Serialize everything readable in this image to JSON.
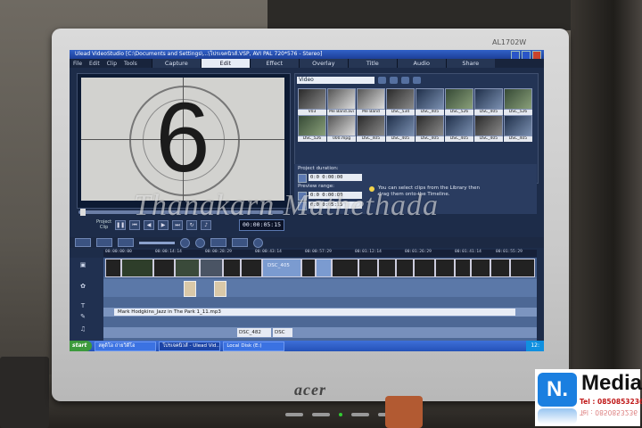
{
  "monitor": {
    "model": "AL1702W",
    "brand": "acer"
  },
  "window": {
    "title": "Ulead VideoStudio [C:\\Documents and Settings\\...\\โปรเจคนิวส์.VSP, AVI PAL 720*576 - Stereo]"
  },
  "menu": {
    "items": [
      "File",
      "Edit",
      "Clip",
      "Tools"
    ],
    "tabs": [
      "Capture",
      "Edit",
      "Effect",
      "Overlay",
      "Title",
      "Audio",
      "Share"
    ],
    "active_tab": "Edit"
  },
  "preview": {
    "countdown_number": "6",
    "project_label": "Project",
    "clip_label": "Clip",
    "timecode": "00:00:05:15"
  },
  "library": {
    "category": "Video",
    "thumbnails": [
      "V03",
      "Me Band.avi",
      "Me Band",
      "DSC_534",
      "DSC_405",
      "DSC_526",
      "DSC_405",
      "DSC_526",
      "DSC_526",
      "000.mpg",
      "DSC_405",
      "DSC_405",
      "DSC_405",
      "DSC_405",
      "DSC_405",
      "DSC_405"
    ]
  },
  "options": {
    "project_duration_label": "Project duration:",
    "project_duration_value": "0:0 0:00:00",
    "preview_range_label": "Preview range:",
    "range_start": "0:0 0:00:00",
    "range_end": "0:0 0:05:15",
    "hint": "You can select clips from the Library then drag them onto the Timeline."
  },
  "timeline": {
    "ruler_ticks": [
      "00:00:00:00",
      "00:00:14:14",
      "00:00:28:29",
      "00:00:43:14",
      "00:00:57:29",
      "00:01:12:14",
      "00:01:26:29",
      "00:01:41:14",
      "00:01:55:29"
    ],
    "video_clip_label": "DSC_405",
    "music_clip_label": "Mark Hodgkins_Jazz in The Park 1_11.mp3",
    "title_clip_labels": [
      "DSC_482",
      "DSC"
    ]
  },
  "taskbar": {
    "start": "start",
    "tasks": [
      "สตูดิโอ ถ่ายวิดีโอ",
      "โปรเจคนิวส์ - Ulead Vid...",
      "Local Disk (E:)"
    ],
    "clock": "12:"
  },
  "watermark": "Thanakarn Mathethada",
  "logo": {
    "letter": "N.",
    "name": "Media",
    "tel": "Tel : 0850853236"
  },
  "colors": {
    "screen_bg": "#1d2c49",
    "accent_blue": "#1a7fe0",
    "tel_red": "#c01818"
  }
}
